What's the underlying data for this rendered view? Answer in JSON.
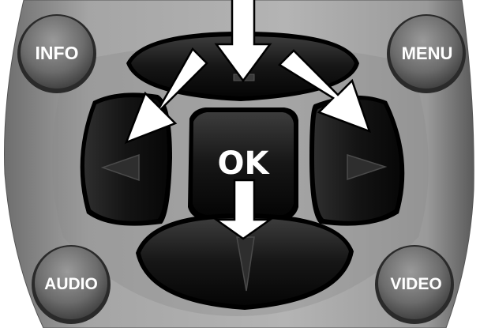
{
  "remote": {
    "buttons": {
      "info": "INFO",
      "menu": "MENU",
      "ok": "OK",
      "audio": "AUDIO",
      "video": "VIDEO"
    }
  },
  "colors": {
    "remote_body": "#9a9a9a",
    "button_dark": "#1a1a1a",
    "round_button": "#7b7b7b",
    "arrow": "#ffffff",
    "arrow_outline": "#000000"
  },
  "icons": [
    "arrow-up-icon",
    "arrow-down-icon",
    "arrow-left-icon",
    "arrow-right-icon",
    "instruction-arrow-icon"
  ]
}
